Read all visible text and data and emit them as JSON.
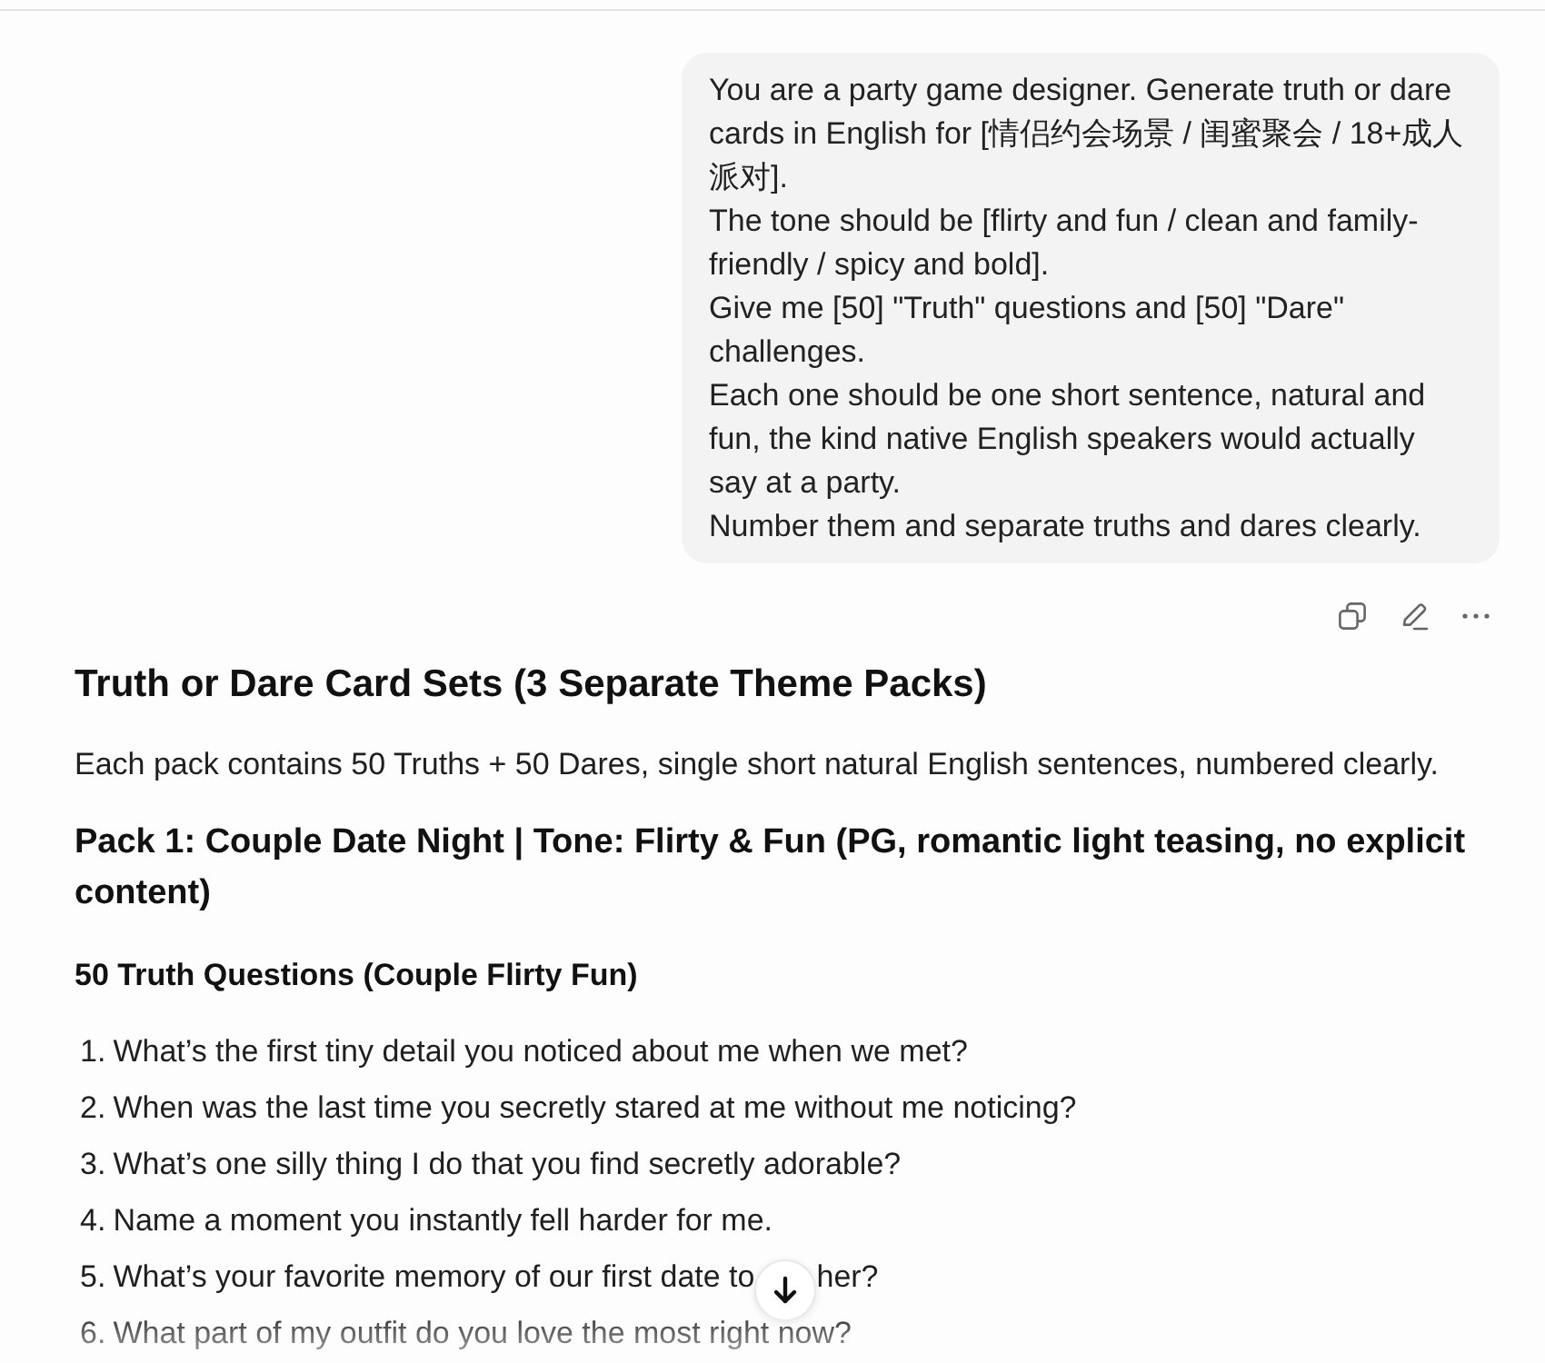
{
  "user_message": {
    "text": "You are a party game designer. Generate truth or dare cards in English for [情侣约会场景 / 闺蜜聚会 / 18+成人派对].\nThe tone should be [flirty and fun / clean and family-friendly / spicy and bold].\nGive me [50] \"Truth\" questions and [50] \"Dare\" challenges.\nEach one should be one short sentence, natural and fun, the kind native English speakers would actually say at a party.\nNumber them and separate truths and dares clearly."
  },
  "response": {
    "title": "Truth or Dare Card Sets (3 Separate Theme Packs)",
    "intro": "Each pack contains 50 Truths + 50 Dares, single short natural English sentences, numbered clearly.",
    "sections": [
      {
        "heading": "Pack 1: Couple Date Night | Tone: Flirty & Fun (PG, romantic light teasing, no explicit content)",
        "subsections": [
          {
            "heading": "50 Truth Questions (Couple Flirty Fun)",
            "items": [
              {
                "number": "1.",
                "text": "What’s the first tiny detail you noticed about me when we met?"
              },
              {
                "number": "2.",
                "text": "When was the last time you secretly stared at me without me noticing?"
              },
              {
                "number": "3.",
                "text": "What’s one silly thing I do that you find secretly adorable?"
              },
              {
                "number": "4.",
                "text": "Name a moment you instantly fell harder for me."
              },
              {
                "number": "5.",
                "text": "What’s your favorite memory of our first date to",
                "text_end": "her?"
              },
              {
                "number": "6.",
                "text": "What part of my outfit do you love the most right now?"
              }
            ]
          }
        ]
      }
    ]
  }
}
